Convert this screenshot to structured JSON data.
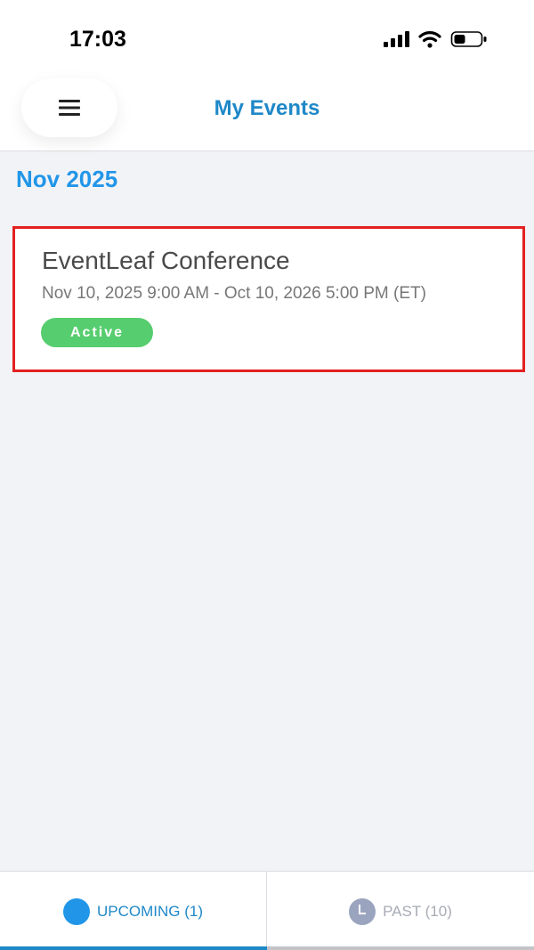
{
  "status_bar": {
    "time": "17:03",
    "icons": [
      "cellular-signal-icon",
      "wifi-icon",
      "battery-icon"
    ]
  },
  "header": {
    "title": "My Events",
    "menu_icon": "hamburger-menu-icon"
  },
  "section": {
    "month_heading": "Nov 2025"
  },
  "events": [
    {
      "title": "EventLeaf Conference",
      "dates": "Nov 10, 2025 9:00 AM - Oct 10, 2026 5:00 PM (ET)",
      "status": "Active"
    }
  ],
  "tabs": {
    "upcoming_label": "UPCOMING (1)",
    "past_label": "PAST (10)"
  },
  "colors": {
    "accent": "#1e88c8",
    "month_heading": "#2196e8",
    "active_badge": "#56cd6e",
    "highlight_border": "#e32121",
    "upcoming_underline": "#1e88c8",
    "past_underline": "#c4c4c8"
  }
}
